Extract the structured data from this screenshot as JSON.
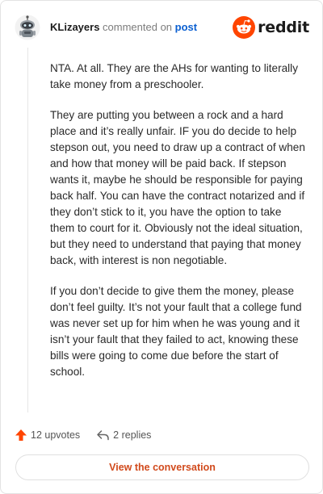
{
  "header": {
    "username": "KLizayers",
    "action_text": "commented on",
    "post_link": "post",
    "brand": "reddit"
  },
  "comment": {
    "paragraphs": [
      "NTA. At all. They are the AHs for wanting to literally take money from a preschooler.",
      "They are putting you between a rock and a hard place and it’s really unfair. IF you do decide to help stepson out, you need to draw up a contract of when and how that money will be paid back. If stepson wants it, maybe he should be responsible for paying back half. You can have the contract notarized and if they don’t stick to it, you have the option to take them to court for it. Obviously not the ideal situation, but they need to understand that paying that money back, with interest is non negotiable.",
      "If you don’t decide to give them the money, please don’t feel guilty. It’s not your fault that a college fund was never set up for him when he was young and it isn’t your fault that they failed to act, knowing these bills were going to come due before the start of school."
    ]
  },
  "footer": {
    "upvotes": "12 upvotes",
    "replies": "2 replies",
    "view_button": "View the conversation"
  },
  "colors": {
    "accent": "#ff4500",
    "link": "#0a5fd1",
    "button_text": "#d14a1c"
  }
}
